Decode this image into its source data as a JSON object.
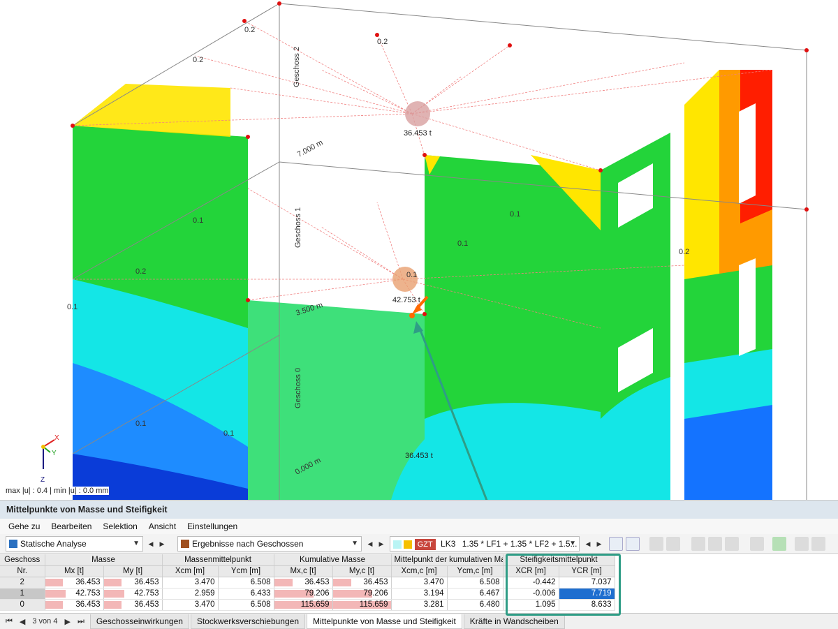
{
  "viewport": {
    "status_text": "max |u| : 0.4 | min |u| : 0.0 mm",
    "axis_x": "X",
    "axis_y": "Y",
    "axis_z": "Z",
    "story_labels": [
      "Geschoss 2",
      "Geschoss 1",
      "Geschoss 0"
    ],
    "mass_labels": [
      "36.453 t",
      "42.753 t",
      "36.453 t"
    ],
    "dim_labels": [
      "7.000 m",
      "3.500 m",
      "0.000 m"
    ],
    "value_labels": [
      "0.2",
      "0.2",
      "0.2",
      "0.2",
      "0.2",
      "0.1",
      "0.1",
      "0.1",
      "0.1",
      "0.1",
      "0.1",
      "0.1"
    ],
    "colors": {
      "green": "#23d43a",
      "cyan": "#14e6e6",
      "blue": "#1473ff",
      "yellow": "#ffe600",
      "orange": "#ff9a00",
      "red": "#ff1e00",
      "callout": "#2f9d86"
    }
  },
  "panel": {
    "title": "Mittelpunkte von Masse und Steifigkeit",
    "menu": [
      "Gehe zu",
      "Bearbeiten",
      "Selektion",
      "Ansicht",
      "Einstellungen"
    ],
    "toolbar": {
      "analysis": "Statische Analyse",
      "results": "Ergebnisse nach Geschossen",
      "combo_badge": "GZT",
      "combo_id": "LK3",
      "combo_text": "1.35 * LF1 + 1.35 * LF2 + 1.5..."
    },
    "table": {
      "group_headers": [
        "Geschoss",
        "Masse",
        "Massenmittelpunkt",
        "Kumulative Masse",
        "Mittelpunkt der kumulativen Masse",
        "Steifigkeitsmittelpunkt"
      ],
      "sub_headers": [
        "Nr.",
        "Mx [t]",
        "My [t]",
        "Xcm [m]",
        "Ycm [m]",
        "Mx,c [t]",
        "My,c [t]",
        "Xcm,c [m]",
        "Ycm,c [m]",
        "XCR [m]",
        "YCR [m]"
      ],
      "rows": [
        {
          "nr": "2",
          "mx": "36.453",
          "my": "36.453",
          "xcm": "3.470",
          "ycm": "6.508",
          "mxc": "36.453",
          "myc": "36.453",
          "xcmc": "3.470",
          "ycmc": "6.508",
          "xcr": "-0.442",
          "ycr": "7.037",
          "mx_frac": 0.305,
          "mxc_frac": 0.315
        },
        {
          "nr": "1",
          "mx": "42.753",
          "my": "42.753",
          "xcm": "2.959",
          "ycm": "6.433",
          "mxc": "79.206",
          "myc": "79.206",
          "xcmc": "3.194",
          "ycmc": "6.467",
          "xcr": "-0.006",
          "ycr": "7.719",
          "mx_frac": 0.358,
          "mxc_frac": 0.685
        },
        {
          "nr": "0",
          "mx": "36.453",
          "my": "36.453",
          "xcm": "3.470",
          "ycm": "6.508",
          "mxc": "115.659",
          "myc": "115.659",
          "xcmc": "3.281",
          "ycmc": "6.480",
          "xcr": "1.095",
          "ycr": "8.633",
          "mx_frac": 0.305,
          "mxc_frac": 1.0
        }
      ]
    },
    "tabs": {
      "page": "3 von 4",
      "items": [
        "Geschosseinwirkungen",
        "Stockwerksverschiebungen",
        "Mittelpunkte von Masse und Steifigkeit",
        "Kräfte in Wandscheiben"
      ],
      "active_index": 2
    }
  }
}
